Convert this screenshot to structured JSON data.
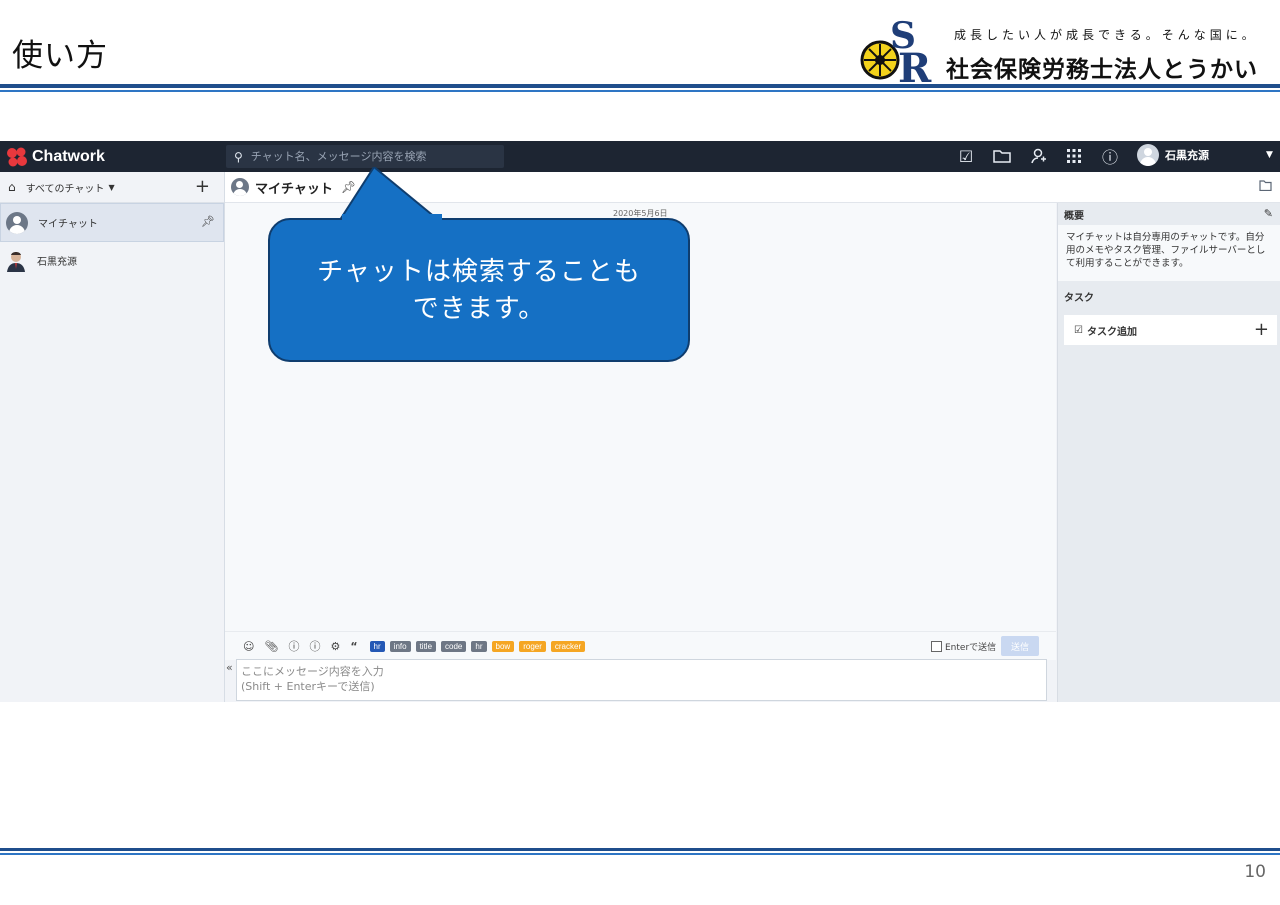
{
  "slide": {
    "title": "使い方",
    "page_number": "10",
    "logo": {
      "tagline": "成長したい人が成長できる。そんな国に。",
      "company": "社会保険労務士法人とうかい",
      "monogram": "SR"
    }
  },
  "app": {
    "brand": "Chatwork",
    "search": {
      "placeholder": "チャット名、メッセージ内容を検索"
    },
    "user": {
      "name": "石黒充源"
    },
    "sidebar": {
      "filter_label": "すべてのチャット",
      "rooms": [
        {
          "name": "マイチャット",
          "pinned": true
        },
        {
          "name": "石黒充源"
        }
      ]
    },
    "chat": {
      "title": "マイチャット",
      "date": "2020年5月6日"
    },
    "composer": {
      "tags": [
        "hr",
        "info",
        "title",
        "code",
        "hr",
        "bow",
        "roger",
        "cracker"
      ],
      "enter_send_label": "Enterで送信",
      "send_label": "送信",
      "placeholder": "ここにメッセージ内容を入力\n(Shift + Enterキーで送信)"
    },
    "right_panel": {
      "overview_title": "概要",
      "overview_text": "マイチャットは自分専用のチャットです。自分用のメモやタスク管理、ファイルサーバーとして利用することができます。",
      "task_title": "タスク",
      "task_add_label": "タスク追加"
    }
  },
  "callout": {
    "line1": "チャットは検索することも",
    "line2": "できます。"
  }
}
